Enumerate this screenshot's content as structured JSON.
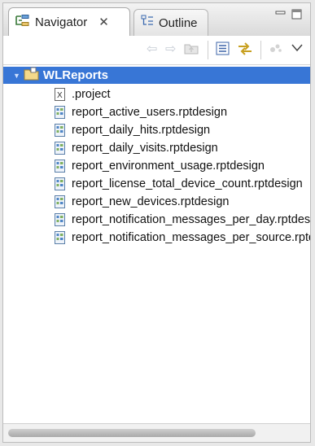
{
  "tabs": {
    "navigator_label": "Navigator",
    "outline_label": "Outline"
  },
  "tree": {
    "root_label": "WLReports",
    "items": [
      ".project",
      "report_active_users.rptdesign",
      "report_daily_hits.rptdesign",
      "report_daily_visits.rptdesign",
      "report_environment_usage.rptdesign",
      "report_license_total_device_count.rptdesign",
      "report_new_devices.rptdesign",
      "report_notification_messages_per_day.rptdesign",
      "report_notification_messages_per_source.rptdesign"
    ]
  },
  "colors": {
    "selection": "#3876d6",
    "panel": "#ffffff"
  }
}
